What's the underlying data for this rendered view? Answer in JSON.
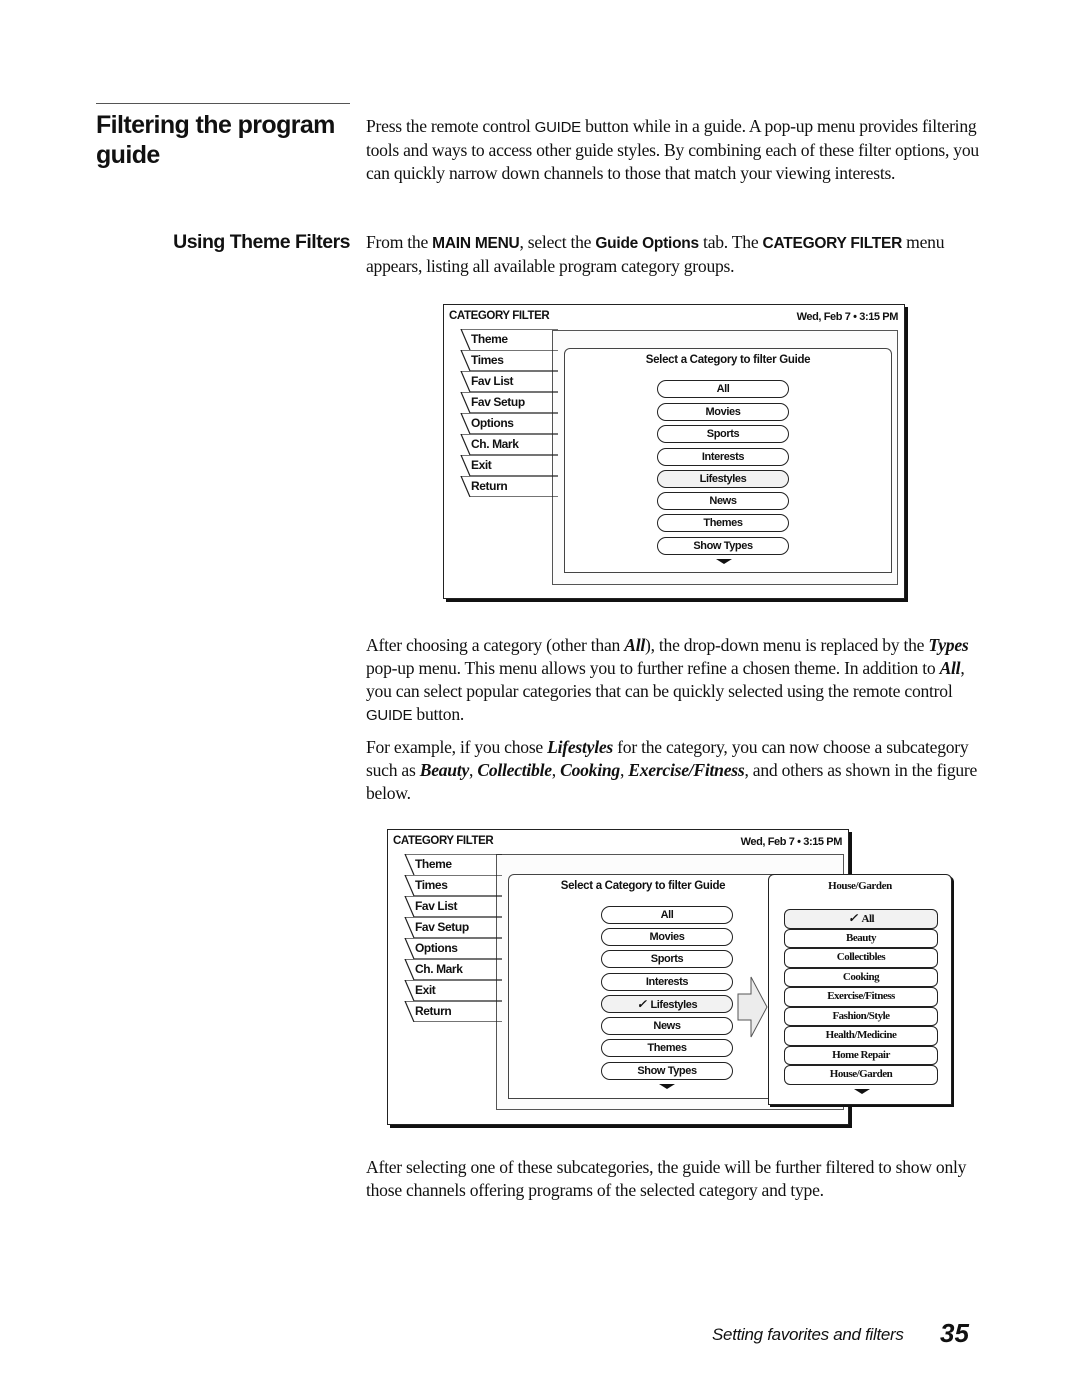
{
  "section": {
    "title": "Filtering the program guide",
    "intro": {
      "t1": "Press the remote control ",
      "guide": "GUIDE",
      "t2": " button while in a guide. A pop-up menu provides filtering tools and ways to access other guide styles. By combining each of these filter options, you can quickly narrow down channels to those that match your viewing interests."
    }
  },
  "subsection": {
    "title": "Using Theme Filters",
    "para1": {
      "t1": "From the ",
      "main_menu": "MAIN MENU",
      "t2": ", select the ",
      "guide_options": "Guide Options",
      "t3": " tab. The ",
      "category_filter": "CATEGORY FILTER",
      "t4": " menu appears, listing all available program category groups."
    },
    "para2": {
      "t1": "After choosing a category (other than ",
      "all1": "All",
      "t2": "), the drop-down menu is replaced by the ",
      "types": "Types",
      "t3": " pop-up menu. This menu allows you to further refine a chosen theme. In addition to ",
      "all2": "All",
      "t4": ", you can select popular categories that can be quickly selected using the remote control ",
      "guide": "GUIDE",
      "t5": " button."
    },
    "para3": {
      "t1": "For example, if you chose ",
      "lifestyles": "Lifestyles",
      "t2": " for the category, you can now choose a subcategory such as ",
      "beauty": "Beauty",
      "c1": ", ",
      "collectible": "Collectible",
      "c2": ", ",
      "cooking": "Cooking",
      "c3": ", ",
      "exercise": "Exercise/Fitness",
      "t3": ", and others as shown in the figure below."
    },
    "para4": "After selecting one of these subcategories, the guide will be further filtered to show only those channels offering programs of the selected category and type."
  },
  "figure1": {
    "title": "CATEGORY FILTER",
    "datetime": "Wed, Feb 7  •  3:15 PM",
    "tabs": [
      "Theme",
      "Times",
      "Fav List",
      "Fav Setup",
      "Options",
      "Ch. Mark",
      "Exit",
      "Return"
    ],
    "panel_heading": "Select a Category to filter Guide",
    "categories": [
      "All",
      "Movies",
      "Sports",
      "Interests",
      "Lifestyles",
      "News",
      "Themes",
      "Show Types"
    ],
    "more_icon": "down-arrow"
  },
  "figure2": {
    "title": "CATEGORY FILTER",
    "datetime": "Wed, Feb 7  •  3:15 PM",
    "tabs": [
      "Theme",
      "Times",
      "Fav List",
      "Fav Setup",
      "Options",
      "Ch. Mark",
      "Exit",
      "Return"
    ],
    "panel_heading": "Select a Category to filter Guide",
    "categories": [
      "All",
      "Movies",
      "Sports",
      "Interests",
      "Lifestyles",
      "News",
      "Themes",
      "Show Types"
    ],
    "selected_category": "Lifestyles",
    "check_glyph": "✓",
    "popup": {
      "title": "House/Garden",
      "items": [
        "All",
        "Beauty",
        "Collectibles",
        "Cooking",
        "Exercise/Fitness",
        "Fashion/Style",
        "Health/Medicine",
        "Home Repair",
        "House/Garden"
      ],
      "selected_item": "All"
    }
  },
  "footer": {
    "chapter": "Setting favorites and filters",
    "page_number": "35"
  }
}
